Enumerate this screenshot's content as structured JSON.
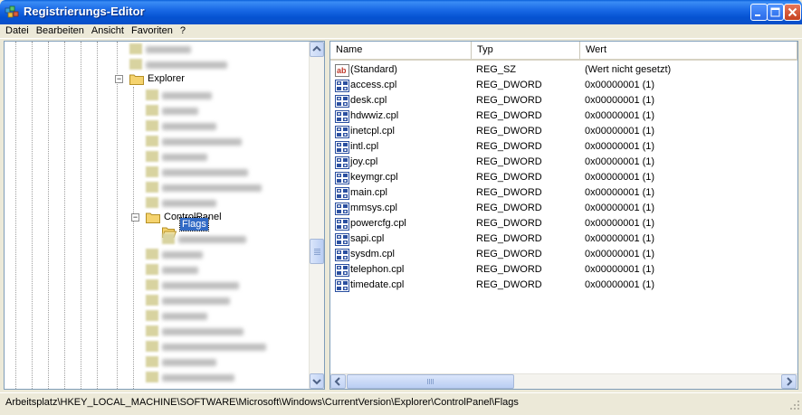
{
  "window": {
    "title": "Registrierungs-Editor",
    "icon": "regedit-icon",
    "controls": [
      "minimize-icon",
      "maximize-icon",
      "close-icon"
    ]
  },
  "menu": {
    "items": [
      {
        "label": "Datei"
      },
      {
        "label": "Bearbeiten"
      },
      {
        "label": "Ansicht"
      },
      {
        "label": "Favoriten"
      },
      {
        "label": "?"
      }
    ]
  },
  "tree": {
    "explorer_label": "Explorer",
    "controlpanel_label": "ControlPanel",
    "selected_label": "Flags",
    "expander_minus": "−"
  },
  "list": {
    "headers": {
      "name": "Name",
      "type": "Typ",
      "value": "Wert"
    },
    "rows": [
      {
        "name": "(Standard)",
        "type": "REG_SZ",
        "value": "(Wert nicht gesetzt)",
        "icon": "string-value-icon"
      },
      {
        "name": "access.cpl",
        "type": "REG_DWORD",
        "value": "0x00000001 (1)",
        "icon": "binary-value-icon"
      },
      {
        "name": "desk.cpl",
        "type": "REG_DWORD",
        "value": "0x00000001 (1)",
        "icon": "binary-value-icon"
      },
      {
        "name": "hdwwiz.cpl",
        "type": "REG_DWORD",
        "value": "0x00000001 (1)",
        "icon": "binary-value-icon"
      },
      {
        "name": "inetcpl.cpl",
        "type": "REG_DWORD",
        "value": "0x00000001 (1)",
        "icon": "binary-value-icon"
      },
      {
        "name": "intl.cpl",
        "type": "REG_DWORD",
        "value": "0x00000001 (1)",
        "icon": "binary-value-icon"
      },
      {
        "name": "joy.cpl",
        "type": "REG_DWORD",
        "value": "0x00000001 (1)",
        "icon": "binary-value-icon"
      },
      {
        "name": "keymgr.cpl",
        "type": "REG_DWORD",
        "value": "0x00000001 (1)",
        "icon": "binary-value-icon"
      },
      {
        "name": "main.cpl",
        "type": "REG_DWORD",
        "value": "0x00000001 (1)",
        "icon": "binary-value-icon"
      },
      {
        "name": "mmsys.cpl",
        "type": "REG_DWORD",
        "value": "0x00000001 (1)",
        "icon": "binary-value-icon"
      },
      {
        "name": "powercfg.cpl",
        "type": "REG_DWORD",
        "value": "0x00000001 (1)",
        "icon": "binary-value-icon"
      },
      {
        "name": "sapi.cpl",
        "type": "REG_DWORD",
        "value": "0x00000001 (1)",
        "icon": "binary-value-icon"
      },
      {
        "name": "sysdm.cpl",
        "type": "REG_DWORD",
        "value": "0x00000001 (1)",
        "icon": "binary-value-icon"
      },
      {
        "name": "telephon.cpl",
        "type": "REG_DWORD",
        "value": "0x00000001 (1)",
        "icon": "binary-value-icon"
      },
      {
        "name": "timedate.cpl",
        "type": "REG_DWORD",
        "value": "0x00000001 (1)",
        "icon": "binary-value-icon"
      }
    ]
  },
  "statusbar": {
    "path": "Arbeitsplatz\\HKEY_LOCAL_MACHINE\\SOFTWARE\\Microsoft\\Windows\\CurrentVersion\\Explorer\\ControlPanel\\Flags"
  },
  "colors": {
    "titlebar": "#0a5fd8",
    "selection": "#316ac5",
    "chrome": "#ece9d8",
    "folder": "#f5d36e"
  }
}
